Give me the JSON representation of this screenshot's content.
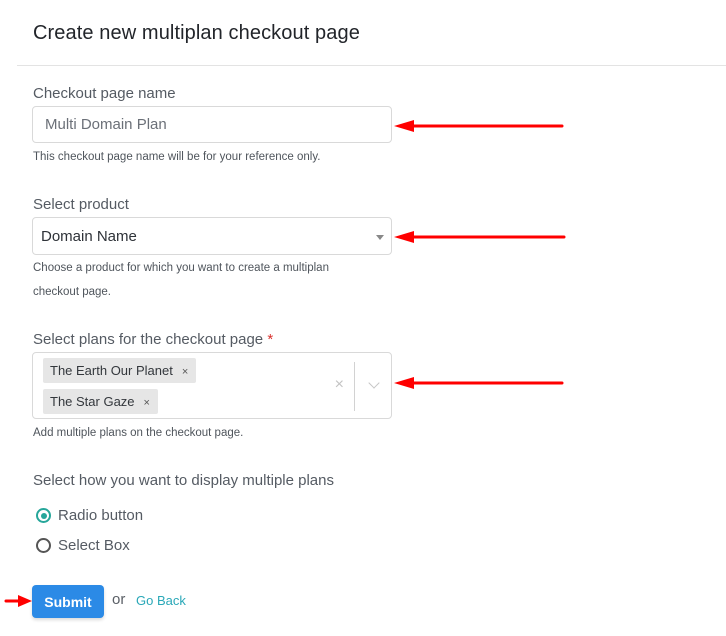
{
  "page": {
    "title": "Create new multiplan checkout page"
  },
  "checkout_name": {
    "label": "Checkout page name",
    "value": "Multi Domain Plan",
    "help": "This checkout page name will be for your reference only."
  },
  "product": {
    "label": "Select product",
    "selected": "Domain Name",
    "help_line1": "Choose a product for which you want to create a multiplan",
    "help_line2": "checkout page."
  },
  "plans": {
    "label": "Select plans for the checkout page",
    "required_mark": "*",
    "selected": [
      {
        "label": "The Earth Our Planet",
        "remove": "×"
      },
      {
        "label": "The Star Gaze",
        "remove": "×"
      }
    ],
    "clear_icon": "×",
    "help": "Add multiple plans on the checkout page."
  },
  "display": {
    "label": "Select how you want to display multiple plans",
    "options": [
      {
        "label": "Radio button",
        "checked": true
      },
      {
        "label": "Select Box",
        "checked": false
      }
    ]
  },
  "actions": {
    "submit_label": "Submit",
    "or_text": "or",
    "go_back_label": "Go Back"
  },
  "colors": {
    "accent_teal": "#26a69a",
    "submit_blue": "#2b8ae6",
    "link_teal": "#2aa8b8",
    "annotation_arrow": "#ff0000",
    "required_red": "#d9302c"
  }
}
